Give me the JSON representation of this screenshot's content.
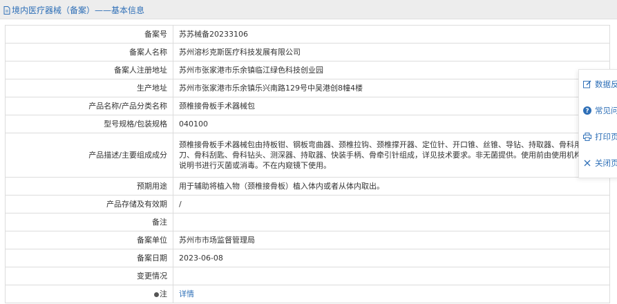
{
  "header": {
    "title": "境内医疗器械（备案）——基本信息"
  },
  "rows": [
    {
      "label": "备案号",
      "value": "苏苏械备20233106"
    },
    {
      "label": "备案人名称",
      "value": "苏州溶杉克斯医疗科技发展有限公司"
    },
    {
      "label": "备案人注册地址",
      "value": "苏州市张家港市乐余镇临江绿色科技创业园"
    },
    {
      "label": "生产地址",
      "value": "苏州市张家港市乐余镇乐兴南路129号中吴港创8幢4楼"
    },
    {
      "label": "产品名称/产品分类名称",
      "value": "颈椎接骨板手术器械包"
    },
    {
      "label": "型号规格/包装规格",
      "value": "040100"
    },
    {
      "label": "产品描述/主要组成成分",
      "value": "颈椎接骨板手术器械包由持板钳、钢板弯曲器、颈椎拉钩、颈椎撑开器、定位针、开口锥、丝锥、导钻、持取器、骨科用螺丝刀、骨科刮匙、骨科钻头、测深器、持取器、快装手柄、骨牵引针组成，详见技术要求。非无菌提供。使用前由使用机构根据说明书进行灭菌或消毒。不在内窥镜下使用。"
    },
    {
      "label": "预期用途",
      "value": "用于辅助将植入物（颈椎接骨板）植入体内或者从体内取出。"
    },
    {
      "label": "产品存储及有效期",
      "value": "/"
    },
    {
      "label": "备注",
      "value": ""
    },
    {
      "label": "备案单位",
      "value": "苏州市市场监督管理局"
    },
    {
      "label": "备案日期",
      "value": "2023-06-08"
    },
    {
      "label": "变更情况",
      "value": ""
    },
    {
      "label": "注",
      "value": "详情"
    }
  ],
  "side_panel": [
    {
      "label": "数据反馈",
      "icon": "edit-icon"
    },
    {
      "label": "常见问题",
      "icon": "question-icon"
    },
    {
      "label": "打印页面",
      "icon": "print-icon"
    },
    {
      "label": "关闭页面",
      "icon": "close-icon"
    }
  ],
  "colors": {
    "link": "#2e6fb7",
    "border": "#dcdcdc",
    "header_bg": "#ededed"
  }
}
